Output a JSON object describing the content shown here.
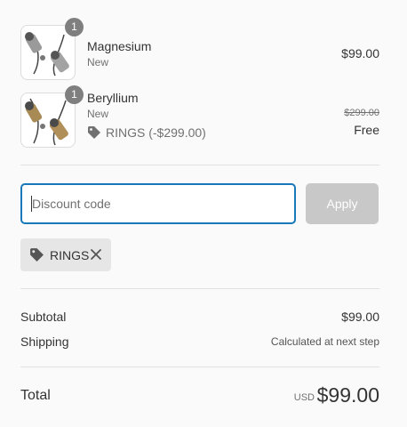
{
  "items": [
    {
      "name": "Magnesium",
      "variant": "New",
      "quantity": "1",
      "price": "$99.00",
      "image": "earbuds-silver-image"
    },
    {
      "name": "Beryllium",
      "variant": "New",
      "quantity": "1",
      "discount_label": "RINGS (-$299.00)",
      "original_price": "$299.00",
      "price": "Free",
      "image": "earbuds-gold-image"
    }
  ],
  "discount": {
    "placeholder": "Discount code",
    "apply_label": "Apply",
    "applied_code": "RINGS"
  },
  "summary": {
    "subtotal_label": "Subtotal",
    "subtotal_value": "$99.00",
    "shipping_label": "Shipping",
    "shipping_value": "Calculated at next step",
    "total_label": "Total",
    "currency": "USD",
    "total_value": "$99.00"
  },
  "colors": {
    "focus_border": "#1878b9",
    "apply_disabled": "#c8c8c8",
    "chip_bg": "#e6e6e6",
    "badge": "#7f7f7f"
  }
}
